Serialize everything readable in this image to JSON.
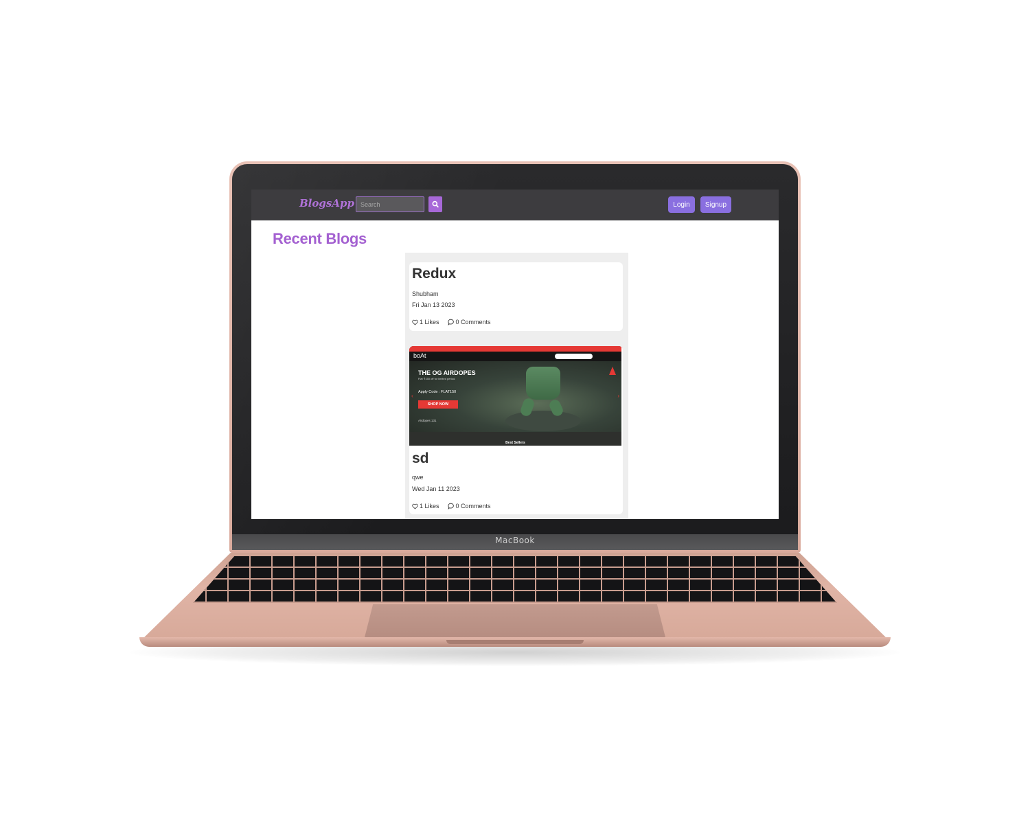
{
  "device": {
    "brand_label": "MacBook"
  },
  "navbar": {
    "logo": "BlogsApp",
    "search": {
      "placeholder": "Search",
      "value": ""
    },
    "login_label": "Login",
    "signup_label": "Signup"
  },
  "page": {
    "heading": "Recent Blogs"
  },
  "posts": [
    {
      "title": "Redux",
      "author": "Shubham",
      "date": "Fri Jan 13 2023",
      "likes": "1 Likes",
      "comments": "0 Comments"
    },
    {
      "title": "sd",
      "author": "qwe",
      "date": "Wed Jan 11 2023",
      "likes": "1 Likes",
      "comments": "0 Comments",
      "image": {
        "logo": "boAt",
        "headline": "THE OG AIRDOPES",
        "sub": "Flat ₹150 off for limited period.",
        "code": "Apply Code : FLAT150",
        "shop_now": "SHOP NOW",
        "product": "Airdopes 131",
        "section": "Best Sellers"
      }
    }
  ],
  "colors": {
    "accent_purple": "#a461d1",
    "button_purple": "#8a6fe0",
    "navbar_bg": "#3d3c3f",
    "device_rose_gold": "#e0b4a6"
  }
}
